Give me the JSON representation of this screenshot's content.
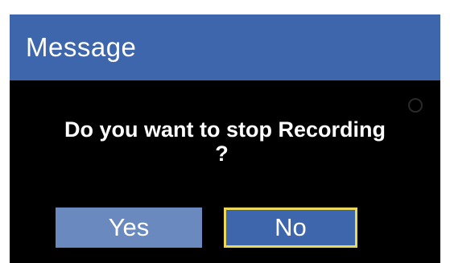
{
  "dialog": {
    "title": "Message",
    "message_line1": "Do you want to stop Recording",
    "message_line2": "?",
    "yes_label": "Yes",
    "no_label": "No",
    "selected_button": "No"
  },
  "colors": {
    "title_bar": "#3d66ac",
    "body": "#000000",
    "yes_button": "#6a89bf",
    "no_button": "#3d66ac",
    "focus_border": "#e9d85a",
    "text": "#ffffff"
  }
}
